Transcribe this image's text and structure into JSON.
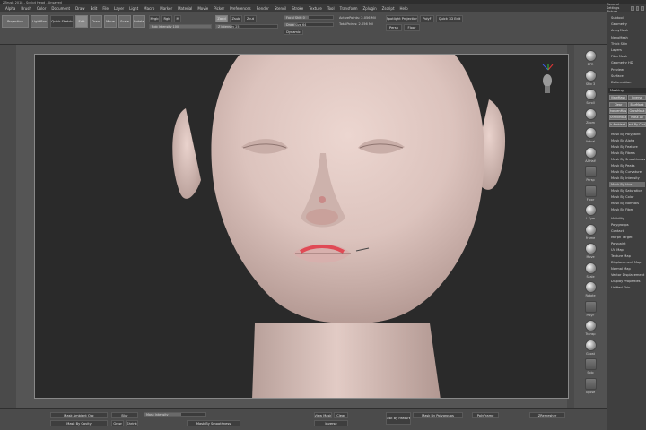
{
  "window": {
    "title": "ZBrush 2018 - Sculpt Head - Unsaved",
    "right_header_label": "General Settings Picture"
  },
  "menu": [
    "Alpha",
    "Brush",
    "Color",
    "Document",
    "Draw",
    "Edit",
    "File",
    "Layer",
    "Light",
    "Macro",
    "Marker",
    "Material",
    "Movie",
    "Picker",
    "Preferences",
    "Render",
    "Stencil",
    "Stroke",
    "Texture",
    "Tool",
    "Transform",
    "Zplugin",
    "Zscript",
    "Help"
  ],
  "top_shelf": {
    "projection_master": "Projection",
    "lightbox": "LightBox",
    "quick_sketch": "Quick Sketch",
    "edit": "Edit",
    "draw": "Draw",
    "move": "Move",
    "scale": "Scale",
    "rotate": "Rotate",
    "mrgb": "Mrgb",
    "rgb": "Rgb",
    "m": "M",
    "zadd": "Zadd",
    "zsub": "Zsub",
    "zcut": "Zcut",
    "focal_shift": "Focal Shift 0",
    "draw_size": "Draw Size 64",
    "dynamic": "Dynamic",
    "rgb_intensity": "Rgb Intensity 100",
    "z_intensity": "Z Intensity 25",
    "active_points": "ActivePoints: 2.056 Mil",
    "total_points": "TotalPoints: 2.056 Mil",
    "spotlight": "Spotlight Projection",
    "polyf": "PolyF",
    "quick3d": "Quick 3D Edit",
    "persp": "Persp",
    "floor": "Floor"
  },
  "tool_strip": [
    {
      "label": "BPR"
    },
    {
      "label": "SPix 3"
    },
    {
      "label": "Scroll"
    },
    {
      "label": "Zoom"
    },
    {
      "label": "Actual"
    },
    {
      "label": "AAHalf"
    },
    {
      "label": "Persp"
    },
    {
      "label": "Floor"
    },
    {
      "label": "L.Sym"
    },
    {
      "label": "Frame"
    },
    {
      "label": "Move"
    },
    {
      "label": "Scale"
    },
    {
      "label": "Rotate"
    },
    {
      "label": "PolyF"
    },
    {
      "label": "Transp"
    },
    {
      "label": "Ghost"
    },
    {
      "label": "Solo"
    },
    {
      "label": "Xpose"
    }
  ],
  "right_panel": {
    "items_top": [
      "Subtool",
      "Geometry",
      "ArrayMesh",
      "NanoMesh",
      "Thick Skin",
      "Layers",
      "FiberMesh",
      "Geometry HD",
      "Preview",
      "Surface",
      "Deformation"
    ],
    "masking_header": "Masking",
    "masking_buttons": [
      "ViewMask",
      "Inverse",
      "Clear",
      "BlurMask",
      "SharpenMask",
      "GrowMask",
      "ShrinkMask",
      "Mask All",
      "Mask Ambient Occ",
      "Mask By Cavity"
    ],
    "masking_items": [
      "Mask By Polypaint",
      "Mask By Alpha",
      "Mask By Feature",
      "Mask By Fibers",
      "Mask By Smoothness",
      "Mask By Peaks",
      "Mask By Curvature",
      "Mask By Intensity",
      "Mask By Hue",
      "Mask By Saturation",
      "Mask By Color",
      "Mask By Normals",
      "Mask By Fiber"
    ],
    "items_bottom": [
      "Visibility",
      "Polygroups",
      "Contact",
      "Morph Target",
      "Polypaint",
      "UV Map",
      "Texture Map",
      "Displacement Map",
      "Normal Map",
      "Vector Displacement",
      "Display Properties",
      "Unified Skin"
    ]
  },
  "bottom_shelf": {
    "mask_ambient": "Mask Ambient Occ",
    "blur": "Blur",
    "mask_by_cavity": "Mask By Cavity",
    "grow": "Grow",
    "shrink": "Shrink",
    "mask_intensity": "Mask Intensity",
    "mask_by_smooth": "Mask By Smoothness",
    "view_mask": "View Mask",
    "clear": "Clear",
    "inverse": "Inverse",
    "mask_by_features": "Mask By Features",
    "mask_by_polygroups": "Mask By Polygroups",
    "polyframe": "PolyFrame",
    "zremesher": "ZRemesher"
  },
  "colors": {
    "canvas_bg": "#2a2a2a",
    "ui_gray": "#4a4a4a",
    "skin": "#dcc3bd"
  }
}
